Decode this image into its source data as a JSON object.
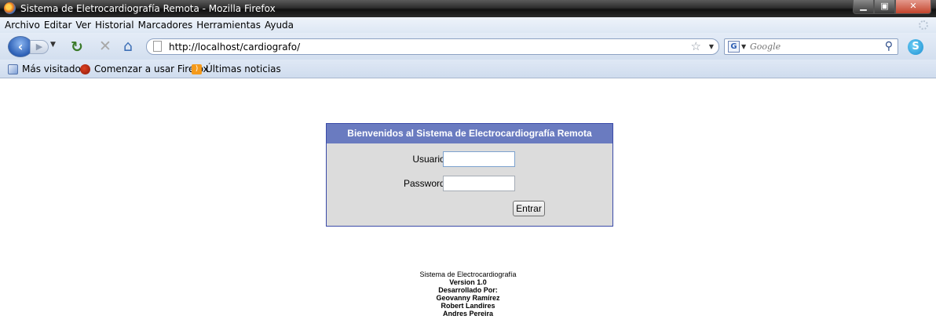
{
  "window": {
    "title": "Sistema de Eletrocardiografía Remota - Mozilla Firefox",
    "controls": {
      "minimize": "▁",
      "maximize": "▣",
      "close": "✕"
    }
  },
  "menu": [
    "Archivo",
    "Editar",
    "Ver",
    "Historial",
    "Marcadores",
    "Herramientas",
    "Ayuda"
  ],
  "nav": {
    "back_glyph": "‹",
    "url": "http://localhost/cardiografo/",
    "search_placeholder": "Google",
    "search_engine": "G"
  },
  "bookmarks": [
    "Más visitados",
    "Comenzar a usar Firefox",
    "Últimas noticias"
  ],
  "login": {
    "header": "Bienvenidos al Sistema de Electrocardiografía Remota",
    "user_label": "Usuario:",
    "user_value": "",
    "password_label": "Password:",
    "password_value": "",
    "submit_label": "Entrar"
  },
  "footer": {
    "line1": "Sistema de Electrocardiografía",
    "version": "Version 1.0",
    "developed_by": "Desarrollado Por:",
    "authors": [
      "Geovanny Ramírez",
      "Robert Landires",
      "Andres Pereira"
    ]
  },
  "colors": {
    "login_header_bg": "#6a7bc0",
    "login_border": "#3a4aa8",
    "login_body_bg": "#dcdcdc"
  }
}
